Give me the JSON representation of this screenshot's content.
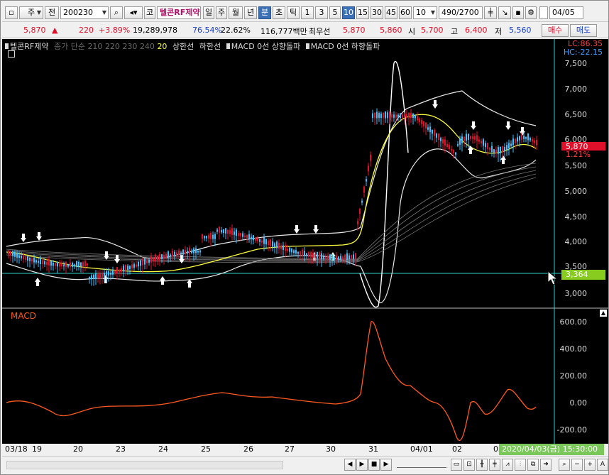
{
  "toolbar": {
    "market": "주",
    "period_type": "전",
    "code": "200230",
    "stock_name": "텔콘RF제약",
    "ko_btn": "코",
    "periods": [
      "일",
      "주",
      "월",
      "년",
      "분",
      "초",
      "틱"
    ],
    "selected_period": "분",
    "intervals": [
      "1",
      "3",
      "5",
      "10",
      "15",
      "30",
      "45",
      "60"
    ],
    "selected_interval": "10",
    "interval_value": "10",
    "count": "490",
    "count_total": "/2700",
    "date": "04/05"
  },
  "quote": {
    "price": "5,870",
    "price_arrow": "▲",
    "change": "220",
    "change_pct": "+3.89%",
    "volume": "19,289,978",
    "vol_ratio": "76.54%",
    "turnover": "22.62%",
    "amount": "116,777백만",
    "best_ask_label": "최우선",
    "best_ask": "5,870",
    "best_bid": "5,860",
    "open_label": "시",
    "open": "5,700",
    "high_label": "고",
    "high": "6,400",
    "low_label": "저",
    "low": "5,560",
    "buy_label": "매수",
    "sell_label": "매도"
  },
  "legend": {
    "title": "텔콘RF제약",
    "ma_label": "종가 단순",
    "ma_values": [
      "210",
      "220",
      "230",
      "240"
    ],
    "ma_active": "20",
    "upper_band": "상한선",
    "lower_band": "하한선",
    "macd_up": "MACD 0선 상향돌파",
    "macd_down": "MACD 0선 하향돌파"
  },
  "indicators": {
    "lc": "LC:86.35",
    "hc": "HC:-22.15",
    "current_price": "5,870",
    "current_pct": "1.21%",
    "cursor_price": "3,364"
  },
  "price_axis": [
    "7,500",
    "7,000",
    "6,500",
    "6,000",
    "5,500",
    "5,000",
    "4,500",
    "4,000",
    "3,500",
    "3,000"
  ],
  "macd_axis": [
    "600.00",
    "400.00",
    "200.00",
    "0.00",
    "-200.00"
  ],
  "macd_label": "MACD",
  "x_axis": [
    "03/18",
    "19",
    "20",
    "23",
    "24",
    "25",
    "26",
    "27",
    "30",
    "31",
    "04/01",
    "02",
    "03"
  ],
  "cursor_datetime": "2020/04/03(금) 15:30:00",
  "colors": {
    "up": "#e0102a",
    "down": "#40c0ff",
    "macd": "#ff5a20",
    "ma20": "#ffff40",
    "cursor": "#00d0d0"
  }
}
